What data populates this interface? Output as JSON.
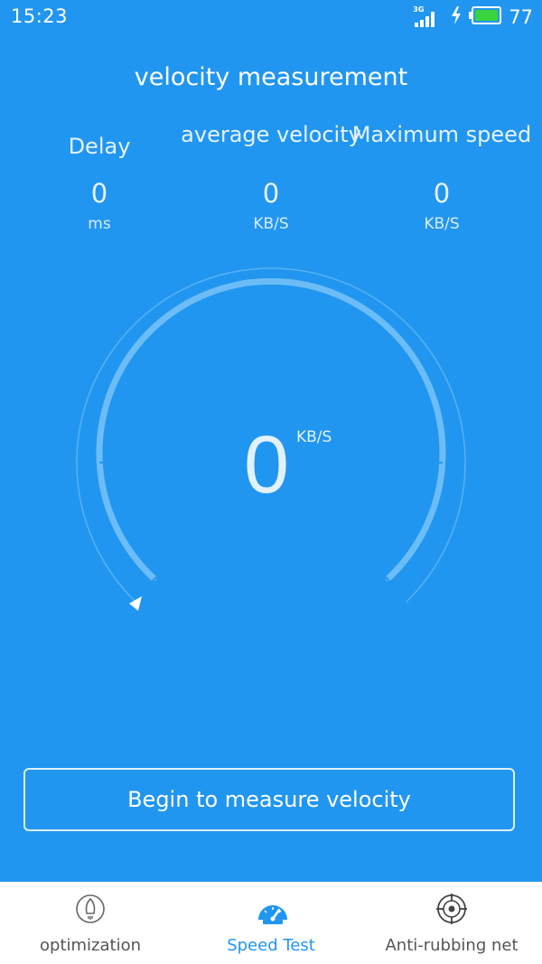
{
  "status_bar": {
    "time": "15:23",
    "network_label": "3G",
    "battery_level": "77",
    "icons": [
      "signal-icon",
      "charging-icon",
      "battery-icon"
    ]
  },
  "title": "velocity measurement",
  "stats": {
    "delay": {
      "label": "Delay",
      "value": "0",
      "unit": "ms"
    },
    "average": {
      "label": "average velocity",
      "value": "0",
      "unit": "KB/S"
    },
    "maximum": {
      "label": "Maximum speed",
      "value": "0",
      "unit": "KB/S"
    }
  },
  "gauge": {
    "value": "0",
    "unit": "KB/S"
  },
  "measure_button_label": "Begin to measure velocity",
  "bottom_nav": {
    "items": [
      {
        "label": "optimization",
        "icon": "rocket-icon",
        "active": false
      },
      {
        "label": "Speed Test",
        "icon": "speedometer-icon",
        "active": true
      },
      {
        "label": "Anti-rubbing net",
        "icon": "crosshair-icon",
        "active": false
      }
    ]
  },
  "colors": {
    "background": "#2196f0",
    "accent": "#2196f0",
    "battery_fill": "#39d33f",
    "nav_inactive": "#555555"
  }
}
